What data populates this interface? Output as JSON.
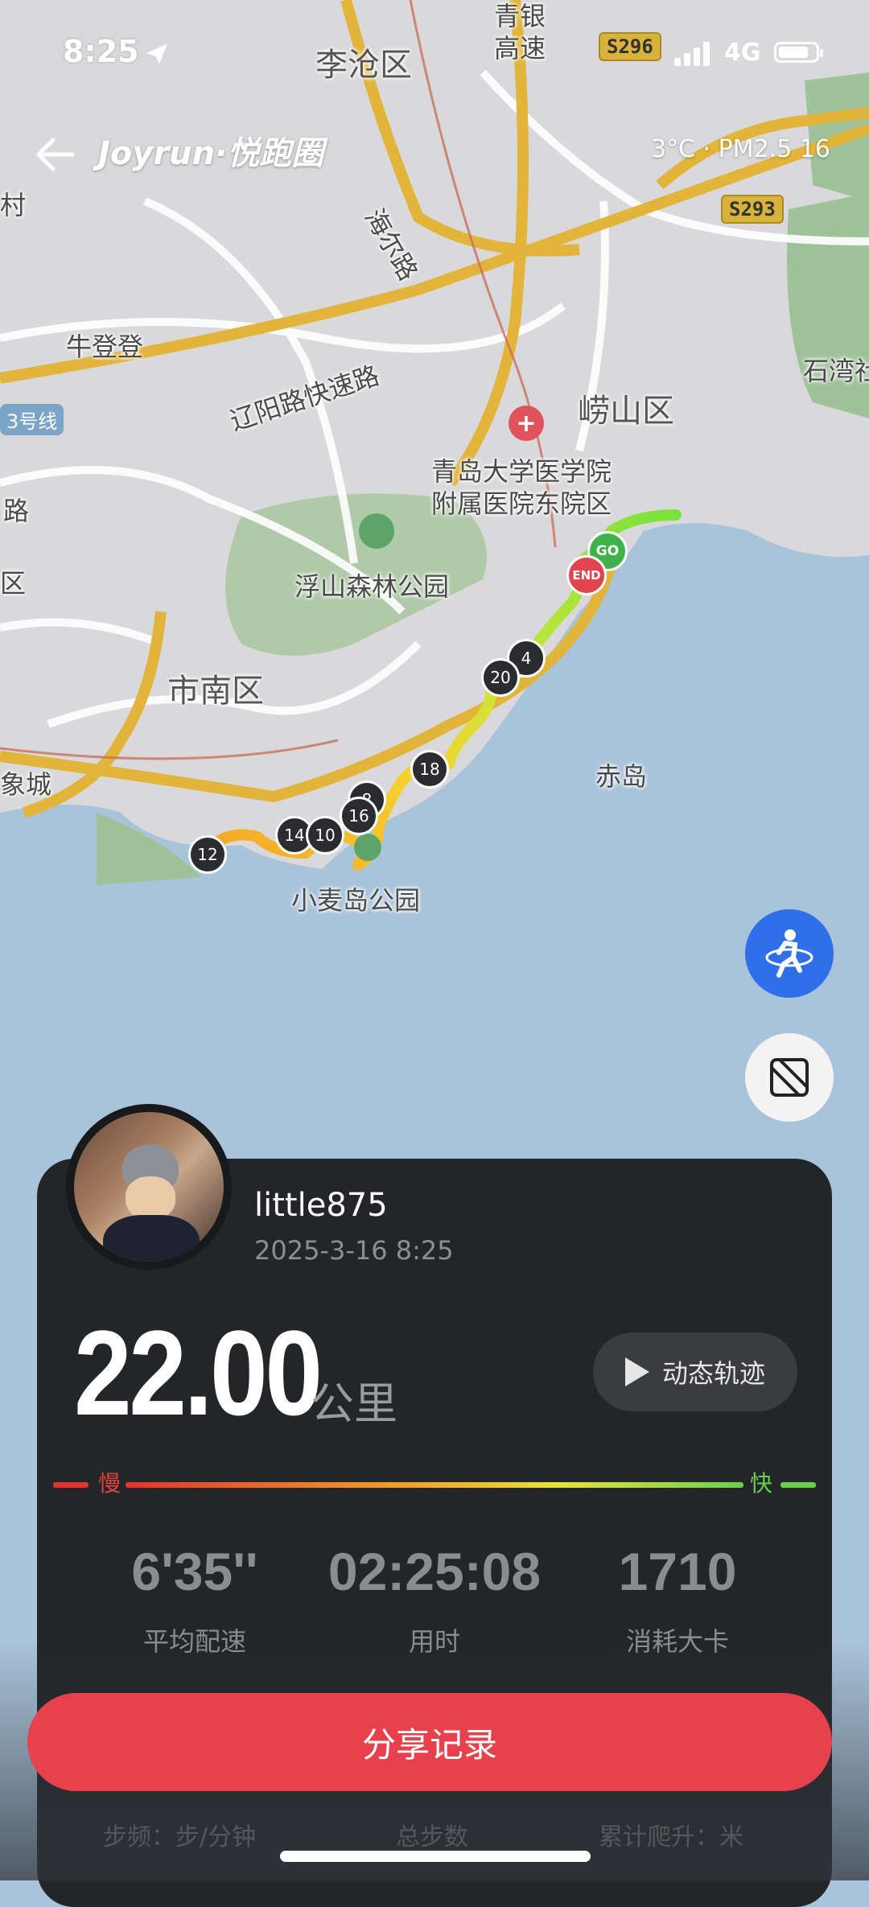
{
  "status_bar": {
    "time": "8:25",
    "carrier": "4G"
  },
  "header": {
    "brand": "Joyrun·悦跑圈",
    "weather": "3°C · PM2.5 16"
  },
  "map": {
    "labels": {
      "licang": "李沧区",
      "laoshan": "崂山区",
      "shinan": "市南区",
      "niudeng": "牛登登",
      "haier": "海尔路",
      "liaoyang": "辽阳路快速路",
      "hospital": "青岛大学医学院\n附属医院东院区",
      "fushan": "浮山森林公园",
      "chidao": "赤岛",
      "xiaomaidao": "小麦岛公园",
      "shiwan": "石湾社",
      "xiangcheng": "象城",
      "qingyin": "青银\n高速",
      "cun": "村",
      "lu": "路",
      "qu": "区"
    },
    "road_badges": {
      "s296": "S296",
      "s293": "S293"
    },
    "metro_badge": "3号线",
    "route_markers": {
      "go": "GO",
      "end": "END"
    },
    "km_markers": [
      "4",
      "20",
      "18",
      "8",
      "16",
      "14",
      "10",
      "12"
    ]
  },
  "buttons": {
    "runner_icon": "runner-icon",
    "map_mode_icon": "map-mode-icon"
  },
  "record": {
    "username": "little875",
    "datetime": "2025-3-16 8:25",
    "distance": "22.00",
    "unit": "公里",
    "dynamic_track": "动态轨迹",
    "speed_slow": "慢",
    "speed_fast": "快",
    "stats": [
      {
        "value": "6'35''",
        "label": "平均配速"
      },
      {
        "value": "02:25:08",
        "label": "用时"
      },
      {
        "value": "1710",
        "label": "消耗大卡"
      }
    ],
    "more_stats": [
      "步频：步/分钟",
      "总步数",
      "累计爬升：米"
    ],
    "share": "分享记录"
  },
  "colors": {
    "accent": "#e7414d",
    "slow": "#e0423a",
    "fast": "#6ad04a",
    "runner_btn": "#2f6fe8"
  }
}
